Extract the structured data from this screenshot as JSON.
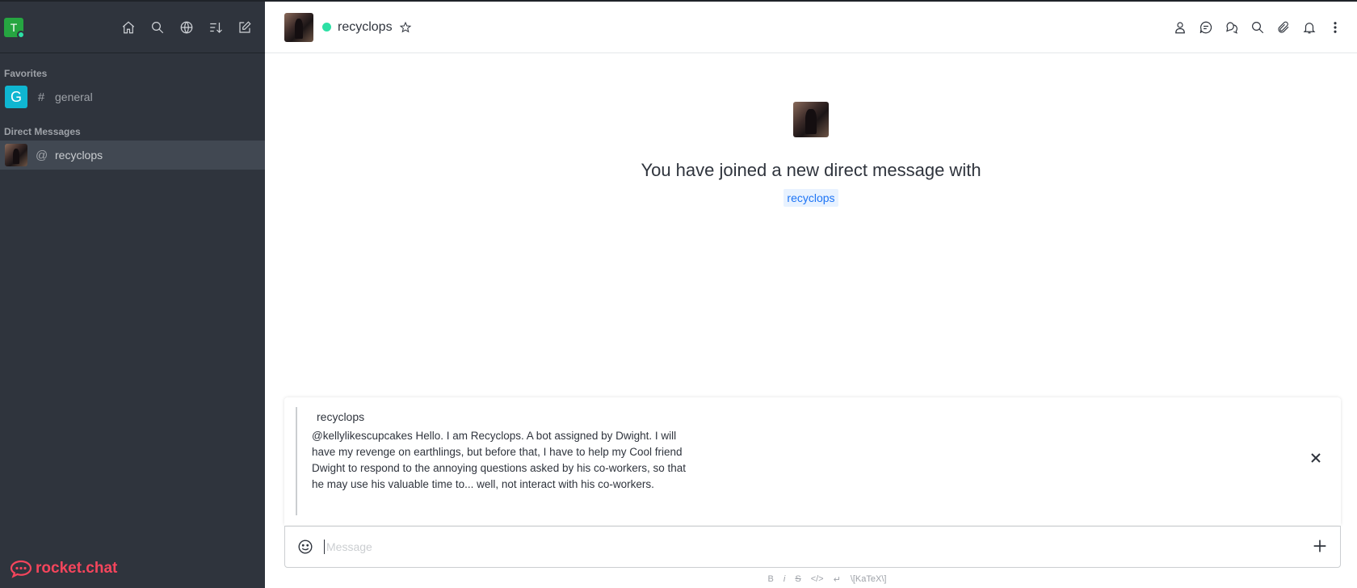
{
  "user": {
    "initial": "T",
    "status_color": "#2de0a5"
  },
  "sidebar": {
    "tools": [
      "home-icon",
      "search-icon",
      "directory-icon",
      "sort-icon",
      "create-new-icon"
    ],
    "favorites_title": "Favorites",
    "favorites": [
      {
        "type": "#",
        "name": "general",
        "initial": "G"
      }
    ],
    "dm_title": "Direct Messages",
    "dms": [
      {
        "type": "@",
        "name": "recyclops"
      }
    ],
    "brand": "rocket.chat"
  },
  "header": {
    "room_name": "recyclops",
    "tools": [
      "user-info-icon",
      "discussion-icon",
      "threads-icon",
      "search-icon",
      "files-icon",
      "notifications-icon",
      "kebab-menu-icon"
    ]
  },
  "welcome": {
    "text": "You have joined a new direct message with",
    "mention": "recyclops"
  },
  "quote": {
    "author": "recyclops",
    "text": "@kellylikescupcakes Hello. I am Recyclops. A bot assigned by Dwight. I will have my revenge on earthlings, but before that, I have to help my Cool friend Dwight to respond to the annoying questions asked by his co-workers, so that he may use his valuable time to... well, not interact with his co-workers."
  },
  "composer": {
    "placeholder": "Message"
  },
  "formatting": {
    "bold": "B",
    "italic": "i",
    "strike": "S",
    "code": "</>",
    "multiline": "↵",
    "katex": "\\[KaTeX\\]"
  },
  "colors": {
    "brand": "#f5455c",
    "accent": "#1d74f5",
    "sidebar_bg": "#2f343d"
  }
}
